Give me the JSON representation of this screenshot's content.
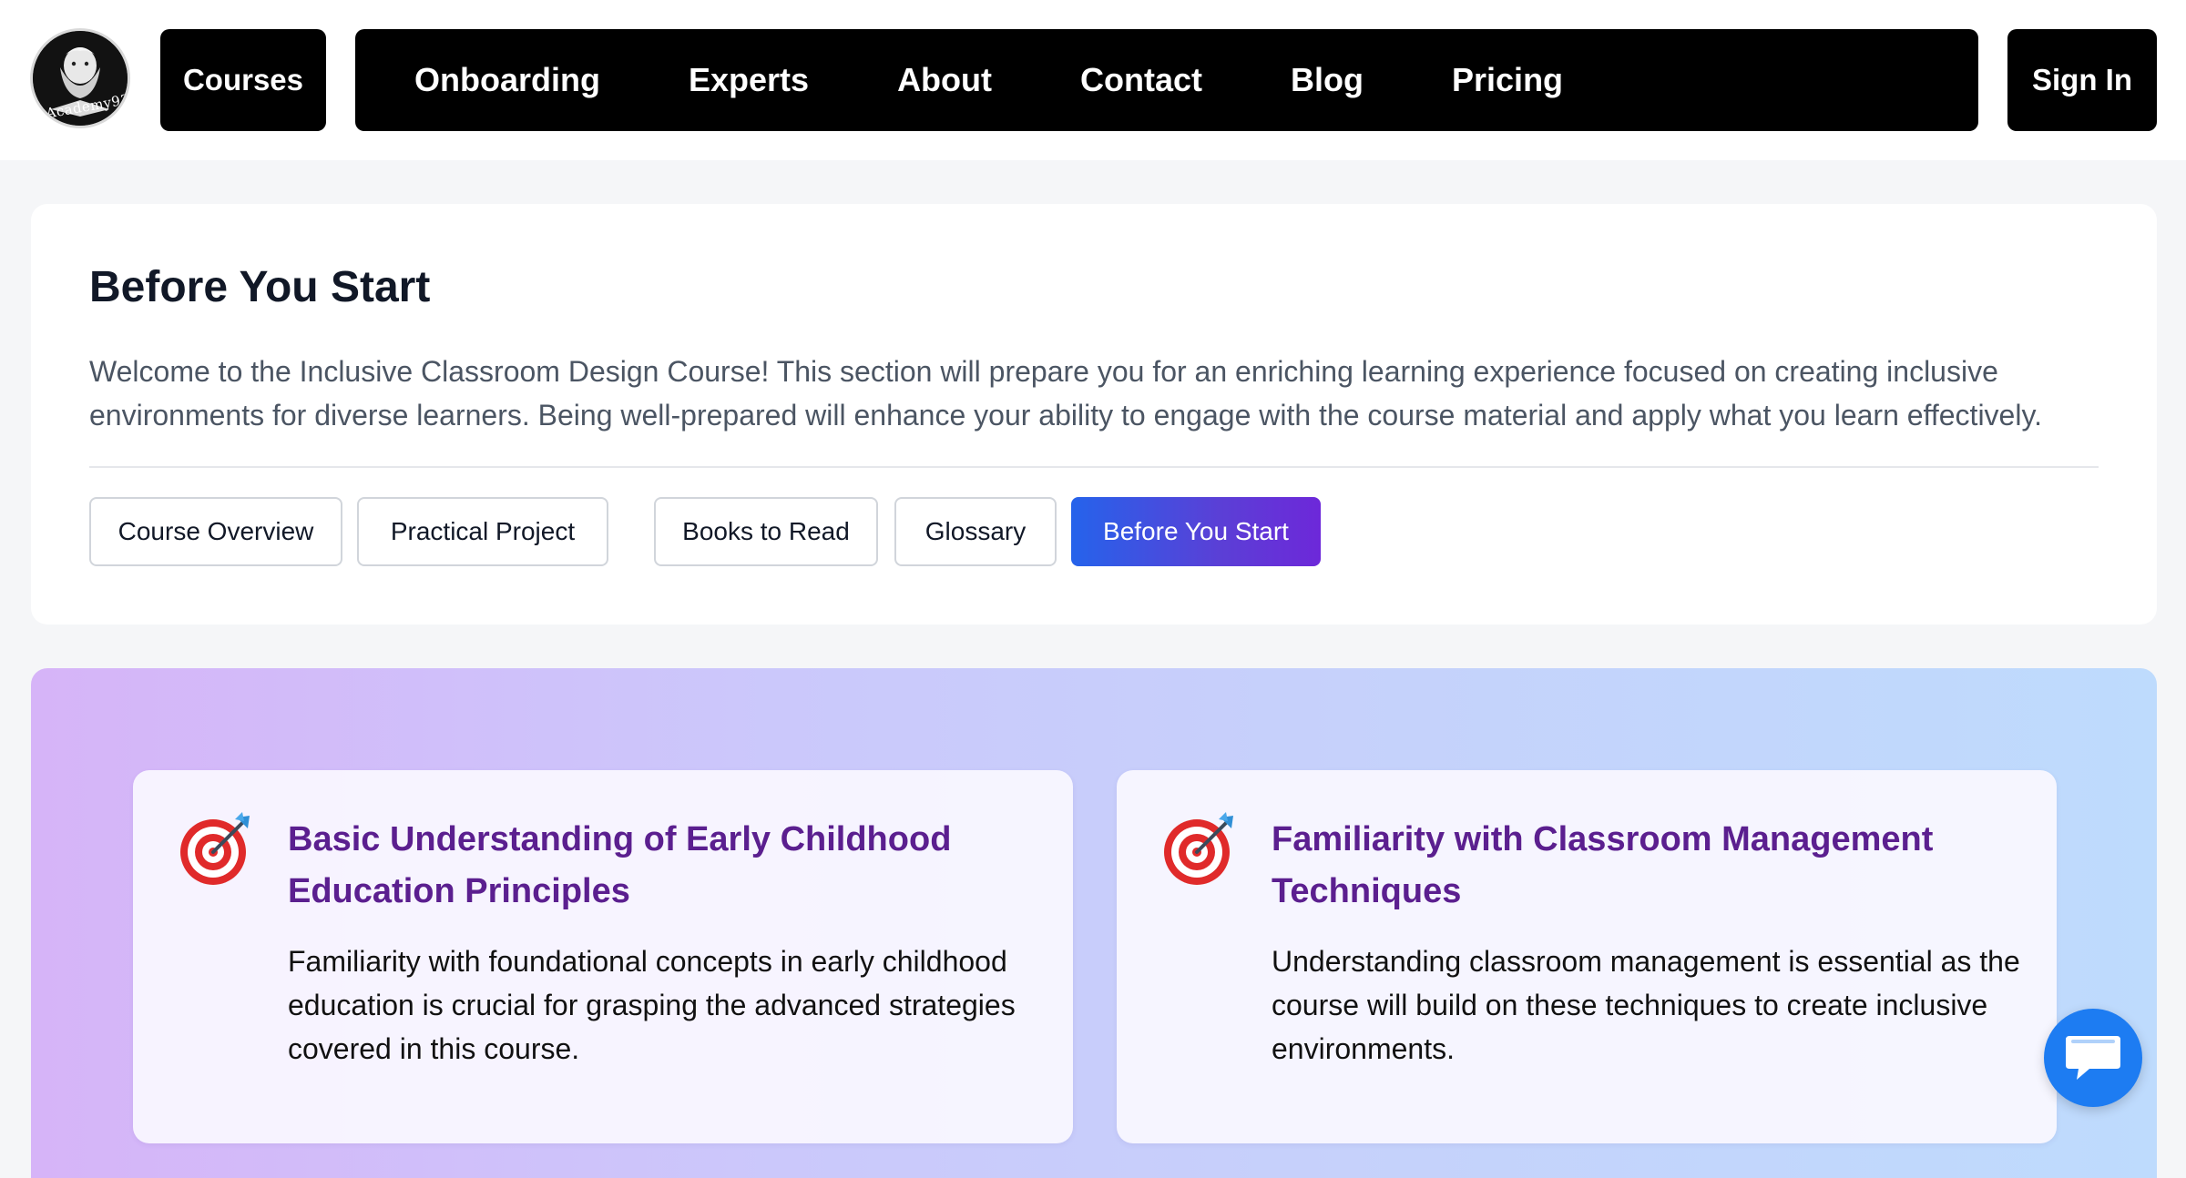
{
  "header": {
    "logo_text": "Academy93",
    "courses_label": "Courses",
    "nav_links": [
      "Onboarding",
      "Experts",
      "About",
      "Contact",
      "Blog",
      "Pricing"
    ],
    "signin_label": "Sign In"
  },
  "intro": {
    "title": "Before You Start",
    "description": "Welcome to the Inclusive Classroom Design Course! This section will prepare you for an enriching learning experience focused on creating inclusive environments for diverse learners. Being well-prepared will enhance your ability to engage with the course material and apply what you learn effectively.",
    "tabs": [
      {
        "label": "Course Overview",
        "active": false
      },
      {
        "label": "Practical Project",
        "active": false
      },
      {
        "label": "Books to Read",
        "active": false
      },
      {
        "label": "Glossary",
        "active": false
      },
      {
        "label": "Before You Start",
        "active": true
      }
    ]
  },
  "requirements": [
    {
      "icon": "target-icon",
      "title": "Basic Understanding of Early Childhood Education Principles",
      "text": "Familiarity with foundational concepts in early childhood education is crucial for grasping the advanced strategies covered in this course."
    },
    {
      "icon": "target-icon",
      "title": "Familiarity with Classroom Management Techniques",
      "text": "Understanding classroom management is essential as the course will build on these techniques to create inclusive environments."
    }
  ],
  "chat": {
    "icon": "chat-bubble-icon"
  },
  "colors": {
    "nav_bg": "#000000",
    "active_tab_start": "#2563eb",
    "active_tab_end": "#6d28d9",
    "card_title": "#5b1f8f",
    "chat_button": "#1d7cf2"
  }
}
